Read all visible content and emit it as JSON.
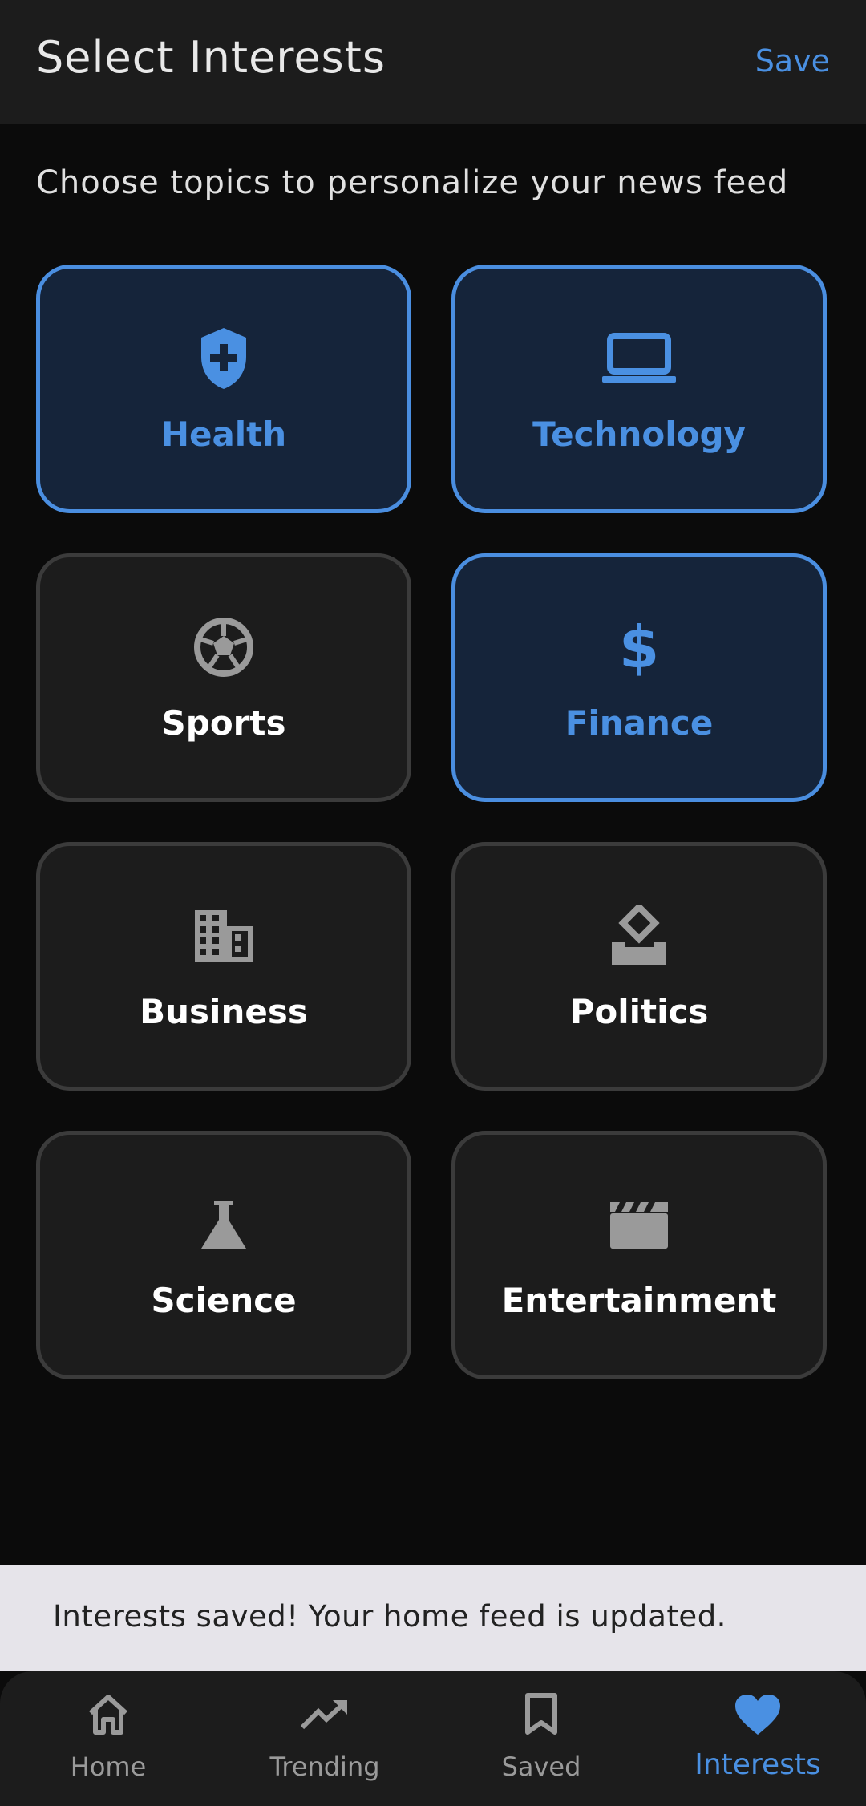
{
  "appbar": {
    "title": "Select Interests",
    "save_label": "Save"
  },
  "subtitle": "Choose topics to personalize your news feed",
  "interests": [
    {
      "label": "Health",
      "icon": "shield-plus-icon",
      "selected": true
    },
    {
      "label": "Technology",
      "icon": "laptop-icon",
      "selected": true
    },
    {
      "label": "Sports",
      "icon": "soccer-ball-icon",
      "selected": false
    },
    {
      "label": "Finance",
      "icon": "dollar-icon",
      "selected": true
    },
    {
      "label": "Business",
      "icon": "building-icon",
      "selected": false
    },
    {
      "label": "Politics",
      "icon": "ballot-box-icon",
      "selected": false
    },
    {
      "label": "Science",
      "icon": "flask-icon",
      "selected": false
    },
    {
      "label": "Entertainment",
      "icon": "clapperboard-icon",
      "selected": false
    }
  ],
  "snackbar": {
    "message": "Interests saved! Your home feed is updated."
  },
  "nav": {
    "items": [
      {
        "label": "Home",
        "icon": "home-icon",
        "active": false
      },
      {
        "label": "Trending",
        "icon": "trending-icon",
        "active": false
      },
      {
        "label": "Saved",
        "icon": "bookmark-icon",
        "active": false
      },
      {
        "label": "Interests",
        "icon": "heart-icon",
        "active": true
      }
    ]
  },
  "colors": {
    "accent": "#4a90e2",
    "selected_card_bg": "#15243a",
    "card_bg": "#1c1c1c",
    "page_bg": "#0b0b0b",
    "snackbar_bg": "#e6e4ea",
    "icon_inactive": "#9a9a9a"
  }
}
